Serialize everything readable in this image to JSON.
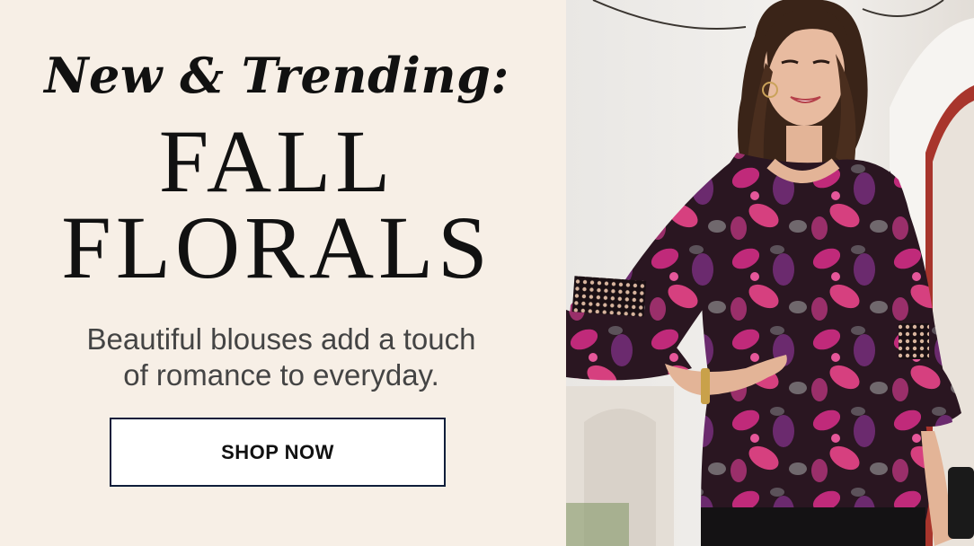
{
  "banner": {
    "kicker": "New & Trending:",
    "headline_line1": "FALL",
    "headline_line2": "FLORALS",
    "copy_line1": "Beautiful blouses add a touch",
    "copy_line2": "of romance to everyday.",
    "cta_label": "SHOP NOW"
  },
  "photo": {
    "subject": "model-wearing-floral-blouse",
    "palette": {
      "blouse_base": "#2a1621",
      "blouse_magenta": "#c02a7a",
      "blouse_purple": "#6b2a6e",
      "hair": "#3a2418",
      "skin": "#e3b497",
      "wall": "#f1eeea",
      "door_red": "#a8352c"
    }
  },
  "colors": {
    "background": "#f7efe6",
    "text_dark": "#111111",
    "text_body": "#444444",
    "cta_border": "#0f1e3a"
  }
}
